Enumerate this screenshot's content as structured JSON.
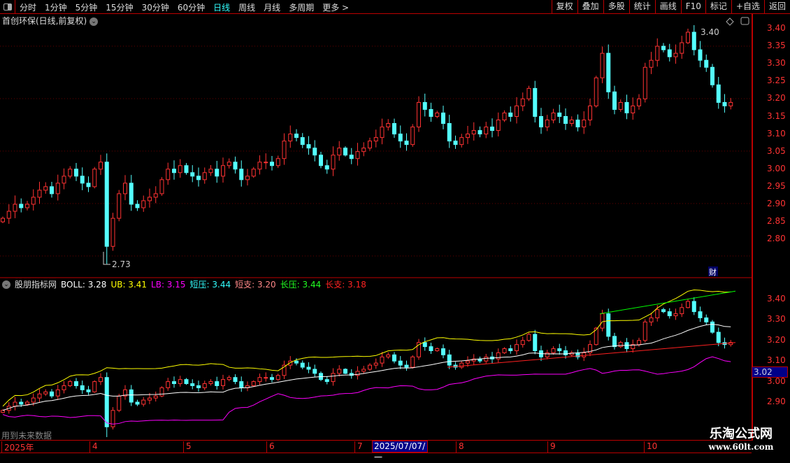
{
  "toolbar": {
    "periods": [
      "分时",
      "1分钟",
      "5分钟",
      "15分钟",
      "30分钟",
      "60分钟",
      "日线",
      "周线",
      "月线",
      "多周期",
      "更多 >"
    ],
    "active": "日线",
    "actions": [
      "复权",
      "叠加",
      "多股",
      "统计",
      "画线",
      "F10",
      "标记",
      "+自选",
      "返回"
    ]
  },
  "main": {
    "title": "首创环保(日线,前复权)",
    "high_label": "3.40",
    "low_label": "2.73",
    "fin_label": "财",
    "axis_ticks": [
      "3.40",
      "3.35",
      "3.30",
      "3.25",
      "3.20",
      "3.15",
      "3.10",
      "3.05",
      "3.00",
      "2.95",
      "2.90",
      "2.85",
      "2.80"
    ]
  },
  "indicator": {
    "name": "股朋指标网",
    "boll": "BOLL: 3.28",
    "ub": "UB: 3.41",
    "lb": "LB: 3.15",
    "dy": "短压: 3.44",
    "dz": "短支: 3.20",
    "cy": "长压: 3.44",
    "cz": "长支: 3.18",
    "axis_ticks": [
      "3.40",
      "3.30",
      "3.20",
      "3.10",
      "3.00",
      "2.90"
    ],
    "current": "3.02",
    "future_note": "用到未来数据",
    "colors": {
      "boll": "#ffffff",
      "ub": "#ffff00",
      "lb": "#ff00ff",
      "dy": "#00ffff",
      "dz": "#ff8080",
      "cy": "#00ff00",
      "cz": "#ff2020"
    }
  },
  "timeaxis": {
    "labels": [
      "2025年",
      "4",
      "5",
      "6",
      "7",
      "8",
      "9",
      "10"
    ],
    "cursor_date": "2025/07/07/一"
  },
  "watermark": {
    "name": "乐淘公式网",
    "url": "www.60lt.com"
  },
  "chart_data": {
    "type": "candlestick",
    "ylim": [
      2.73,
      3.42
    ],
    "up_color": "#ff3232",
    "down_color": "#54ffff",
    "closes": [
      2.86,
      2.88,
      2.9,
      2.89,
      2.9,
      2.92,
      2.94,
      2.95,
      2.93,
      2.96,
      2.98,
      3.0,
      2.98,
      2.96,
      2.95,
      3.0,
      3.02,
      2.78,
      2.86,
      2.93,
      2.96,
      2.9,
      2.89,
      2.91,
      2.92,
      2.93,
      2.97,
      3.0,
      2.99,
      3.01,
      2.99,
      2.98,
      2.97,
      2.99,
      3.0,
      2.98,
      3.01,
      3.02,
      3.0,
      2.97,
      2.98,
      3.0,
      3.02,
      3.02,
      3.01,
      3.03,
      3.08,
      3.1,
      3.09,
      3.07,
      3.06,
      3.04,
      3.01,
      3.0,
      3.04,
      3.06,
      3.04,
      3.03,
      3.05,
      3.06,
      3.08,
      3.09,
      3.12,
      3.13,
      3.1,
      3.08,
      3.07,
      3.12,
      3.19,
      3.17,
      3.15,
      3.16,
      3.13,
      3.08,
      3.07,
      3.09,
      3.1,
      3.11,
      3.1,
      3.12,
      3.11,
      3.14,
      3.16,
      3.15,
      3.18,
      3.2,
      3.23,
      3.15,
      3.12,
      3.14,
      3.16,
      3.15,
      3.13,
      3.14,
      3.12,
      3.14,
      3.18,
      3.26,
      3.33,
      3.22,
      3.17,
      3.19,
      3.16,
      3.18,
      3.2,
      3.29,
      3.31,
      3.35,
      3.34,
      3.32,
      3.33,
      3.36,
      3.39,
      3.34,
      3.31,
      3.29,
      3.24,
      3.19,
      3.18,
      3.19
    ]
  }
}
